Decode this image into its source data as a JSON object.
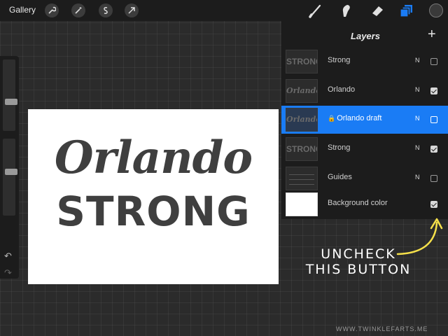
{
  "toolbar": {
    "gallery_label": "Gallery",
    "left_tools": [
      "wrench-icon",
      "magic-wand-icon",
      "selection-icon",
      "transform-arrow-icon"
    ],
    "right_tools": [
      "brush-icon",
      "smudge-icon",
      "eraser-icon",
      "layers-icon"
    ],
    "active_tool_color": "#1a7cf5"
  },
  "canvas": {
    "script_text": "Orlando",
    "block_text": "STRONG"
  },
  "layers_panel": {
    "title": "Layers",
    "add_symbol": "+",
    "layers": [
      {
        "name": "Strong",
        "mode": "N",
        "visible": false,
        "selected": false,
        "thumb": "STRONG",
        "locked": false
      },
      {
        "name": "Orlando",
        "mode": "N",
        "visible": true,
        "selected": false,
        "thumb": "Orlando",
        "locked": false
      },
      {
        "name": "Orlando draft",
        "mode": "N",
        "visible": false,
        "selected": true,
        "thumb": "Orlando",
        "locked": true
      },
      {
        "name": "Strong",
        "mode": "N",
        "visible": true,
        "selected": false,
        "thumb": "STRONG",
        "locked": false
      },
      {
        "name": "Guides",
        "mode": "N",
        "visible": false,
        "selected": false,
        "thumb": "",
        "locked": false
      },
      {
        "name": "Background color",
        "mode": "",
        "visible": true,
        "selected": false,
        "thumb": "",
        "locked": false
      }
    ]
  },
  "annotation": {
    "line1": "UNCHECK",
    "line2": "THIS BUTTON",
    "color": "#f5e04a"
  },
  "watermark": "WWW.TWINKLEFARTS.ME"
}
